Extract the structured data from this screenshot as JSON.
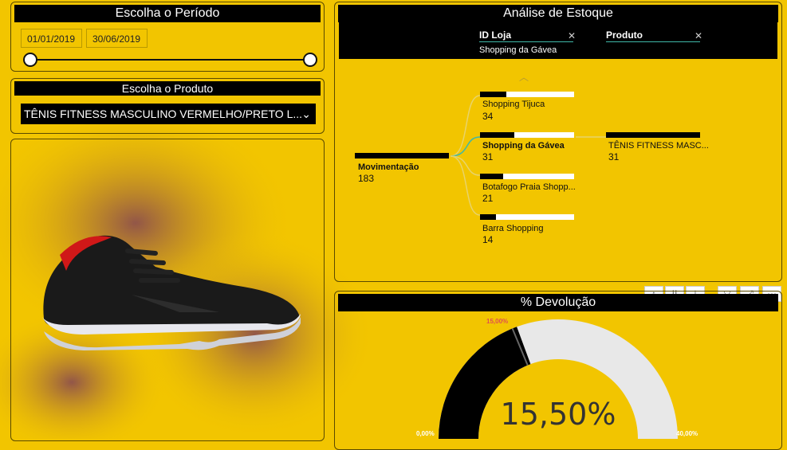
{
  "period": {
    "title": "Escolha o Período",
    "start_date": "01/01/2019",
    "end_date": "30/06/2019"
  },
  "product": {
    "title": "Escolha o Produto",
    "selected": "TÊNIS FITNESS MASCULINO VERMELHO/PRETO L..."
  },
  "stock": {
    "title": "Análise de Estoque",
    "filters": [
      {
        "label": "ID Loja",
        "value": "Shopping da Gávea"
      },
      {
        "label": "Produto",
        "value": ""
      }
    ],
    "root": {
      "label": "Movimentação",
      "value": "183"
    },
    "stores": [
      {
        "label": "Shopping Tijuca",
        "value": "34",
        "fraction": 0.28
      },
      {
        "label": "Shopping da Gávea",
        "value": "31",
        "fraction": 0.36
      },
      {
        "label": "Botafogo Praia Shopp...",
        "value": "21",
        "fraction": 0.25
      },
      {
        "label": "Barra Shopping",
        "value": "14",
        "fraction": 0.17
      }
    ],
    "leaf": {
      "label": "TÊNIS FITNESS MASC...",
      "value": "31"
    }
  },
  "devolucao": {
    "title": "% Devolução",
    "value_text": "15,50%",
    "value": 0.155,
    "target_text": "15,00%",
    "min_text": "0,00%",
    "max_text": "40,00%",
    "min": 0,
    "max": 0.4,
    "target": 0.15
  },
  "colors": {
    "background": "#f2c500",
    "accent": "#3fb8a8"
  },
  "toolbar_icons": [
    "arrow-up-icon",
    "double-arrow-down-icon",
    "hierarchy-icon",
    "filter-icon",
    "focus-mode-icon",
    "more-options-icon"
  ]
}
